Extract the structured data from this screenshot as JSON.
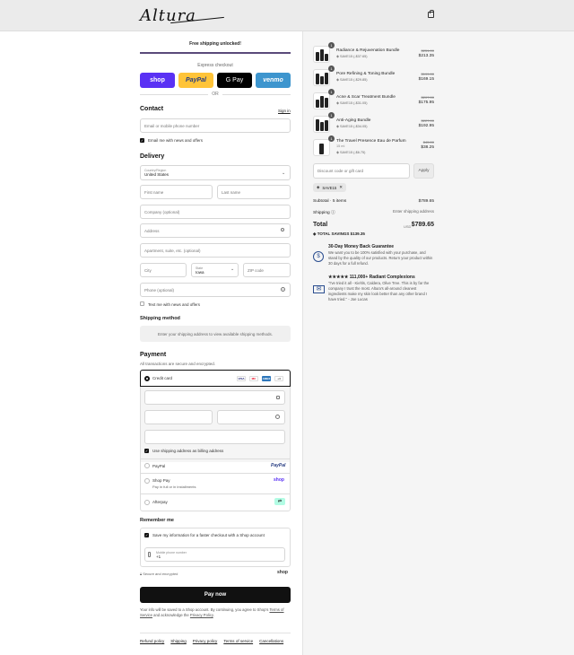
{
  "brand": {
    "logo_text": "Altura"
  },
  "header": {
    "bag_icon": "shopping-bag-icon"
  },
  "shipping_banner": "Free shipping unlocked!",
  "express": {
    "label": "Express checkout",
    "buttons": [
      {
        "label": "shop",
        "bg": "#5a31f4",
        "fg": "#ffffff"
      },
      {
        "label": "PayPal",
        "bg": "#ffc439",
        "fg": "#253b80"
      },
      {
        "label": "G Pay",
        "bg": "#000000",
        "fg": "#ffffff"
      },
      {
        "label": "venmo",
        "bg": "#3d95ce",
        "fg": "#ffffff"
      }
    ],
    "or": "OR"
  },
  "contact": {
    "title": "Contact",
    "sign_in": "Sign in",
    "email_placeholder": "Email or mobile phone number",
    "newsletter": "Email me with news and offers"
  },
  "delivery": {
    "title": "Delivery",
    "country_label": "Country/Region",
    "country_value": "United States",
    "first_name": "First name",
    "last_name": "Last name",
    "company": "Company (optional)",
    "address": "Address",
    "apartment": "Apartment, suite, etc. (optional)",
    "city": "City",
    "state_label": "State",
    "state_value": "Iowa",
    "zip": "ZIP code",
    "phone": "Phone (optional)",
    "text_me": "Text me with news and offers"
  },
  "shipping_method": {
    "title": "Shipping method",
    "message": "Enter your shipping address to view available shipping methods."
  },
  "payment": {
    "title": "Payment",
    "subtitle": "All transactions are secure and encrypted.",
    "credit_card": "Credit card",
    "card_icons": [
      "VISA",
      "MC",
      "AMEX",
      "+4"
    ],
    "billing_same": "Use shipping address as billing address",
    "paypal": "PayPal",
    "paypal_logo": "PayPal",
    "shop_pay": "Shop Pay",
    "shop_pay_sub": "Pay in full or in installments",
    "shop_pay_logo": "shop",
    "afterpay": "Afterpay"
  },
  "remember": {
    "title": "Remember me",
    "save_info": "Save my information for a faster checkout with a Shop account",
    "mobile_label": "Mobile phone number",
    "mobile_value": "+1",
    "secure": "Secure and encrypted",
    "shop_logo": "shop"
  },
  "pay_now": "Pay now",
  "legal": {
    "text1": "Your info will be saved to a Shop account. By continuing, you agree to Shop's",
    "terms": "Terms of Service",
    "and": "and acknowledge the",
    "privacy": "Privacy Policy",
    "end": "."
  },
  "footer_links": [
    "Refund policy",
    "Shipping",
    "Privacy policy",
    "Terms of service",
    "Cancellations"
  ],
  "cart": {
    "items": [
      {
        "name": "Radiance & Rejuvenation Bundle",
        "discount": "SAVE15 (-$37.65)",
        "old_price": "$251.00",
        "price": "$213.35",
        "qty": "1",
        "variant": ""
      },
      {
        "name": "Pore Refining & Toning Bundle",
        "discount": "SAVE15 (-$29.85)",
        "old_price": "$199.00",
        "price": "$169.15",
        "qty": "1",
        "variant": ""
      },
      {
        "name": "Acne & Scar Treatment Bundle",
        "discount": "SAVE15 (-$31.05)",
        "old_price": "$207.00",
        "price": "$175.95",
        "qty": "1",
        "variant": ""
      },
      {
        "name": "Anti-Aging Bundle",
        "discount": "SAVE15 (-$34.05)",
        "old_price": "$227.00",
        "price": "$192.95",
        "qty": "1",
        "variant": ""
      },
      {
        "name": "The Travel Presence Eau de Parfum",
        "discount": "SAVE15 (-$6.75)",
        "old_price": "$45.00",
        "price": "$38.25",
        "qty": "1",
        "variant": "15 ml"
      }
    ],
    "discount_placeholder": "Discount code or gift card",
    "apply": "Apply",
    "applied_code": "SAVE15",
    "subtotal_label": "Subtotal · 5 items",
    "subtotal_value": "$789.65",
    "shipping_label": "Shipping",
    "shipping_value": "Enter shipping address",
    "total_label": "Total",
    "currency": "USD",
    "total_value": "$789.65",
    "savings_label": "TOTAL SAVINGS",
    "savings_value": "$139.35"
  },
  "guarantee": {
    "title": "30-Day Money Back Guarantee",
    "text": "We want you to be 100% satisfied with your purchase, and stand by the quality of our products. Return your product within 30 days for a full refund."
  },
  "review": {
    "title": "★★★★★ 111,000+ Radiant Complexions",
    "text": "\"I've tried it all - Kiehls, Caldera, Olive Tree. This is by far the company I trust the most. Altura's all-around cleanest ingredients make my skin look better than any other brand I have tried.\" - Joe Lucas"
  }
}
